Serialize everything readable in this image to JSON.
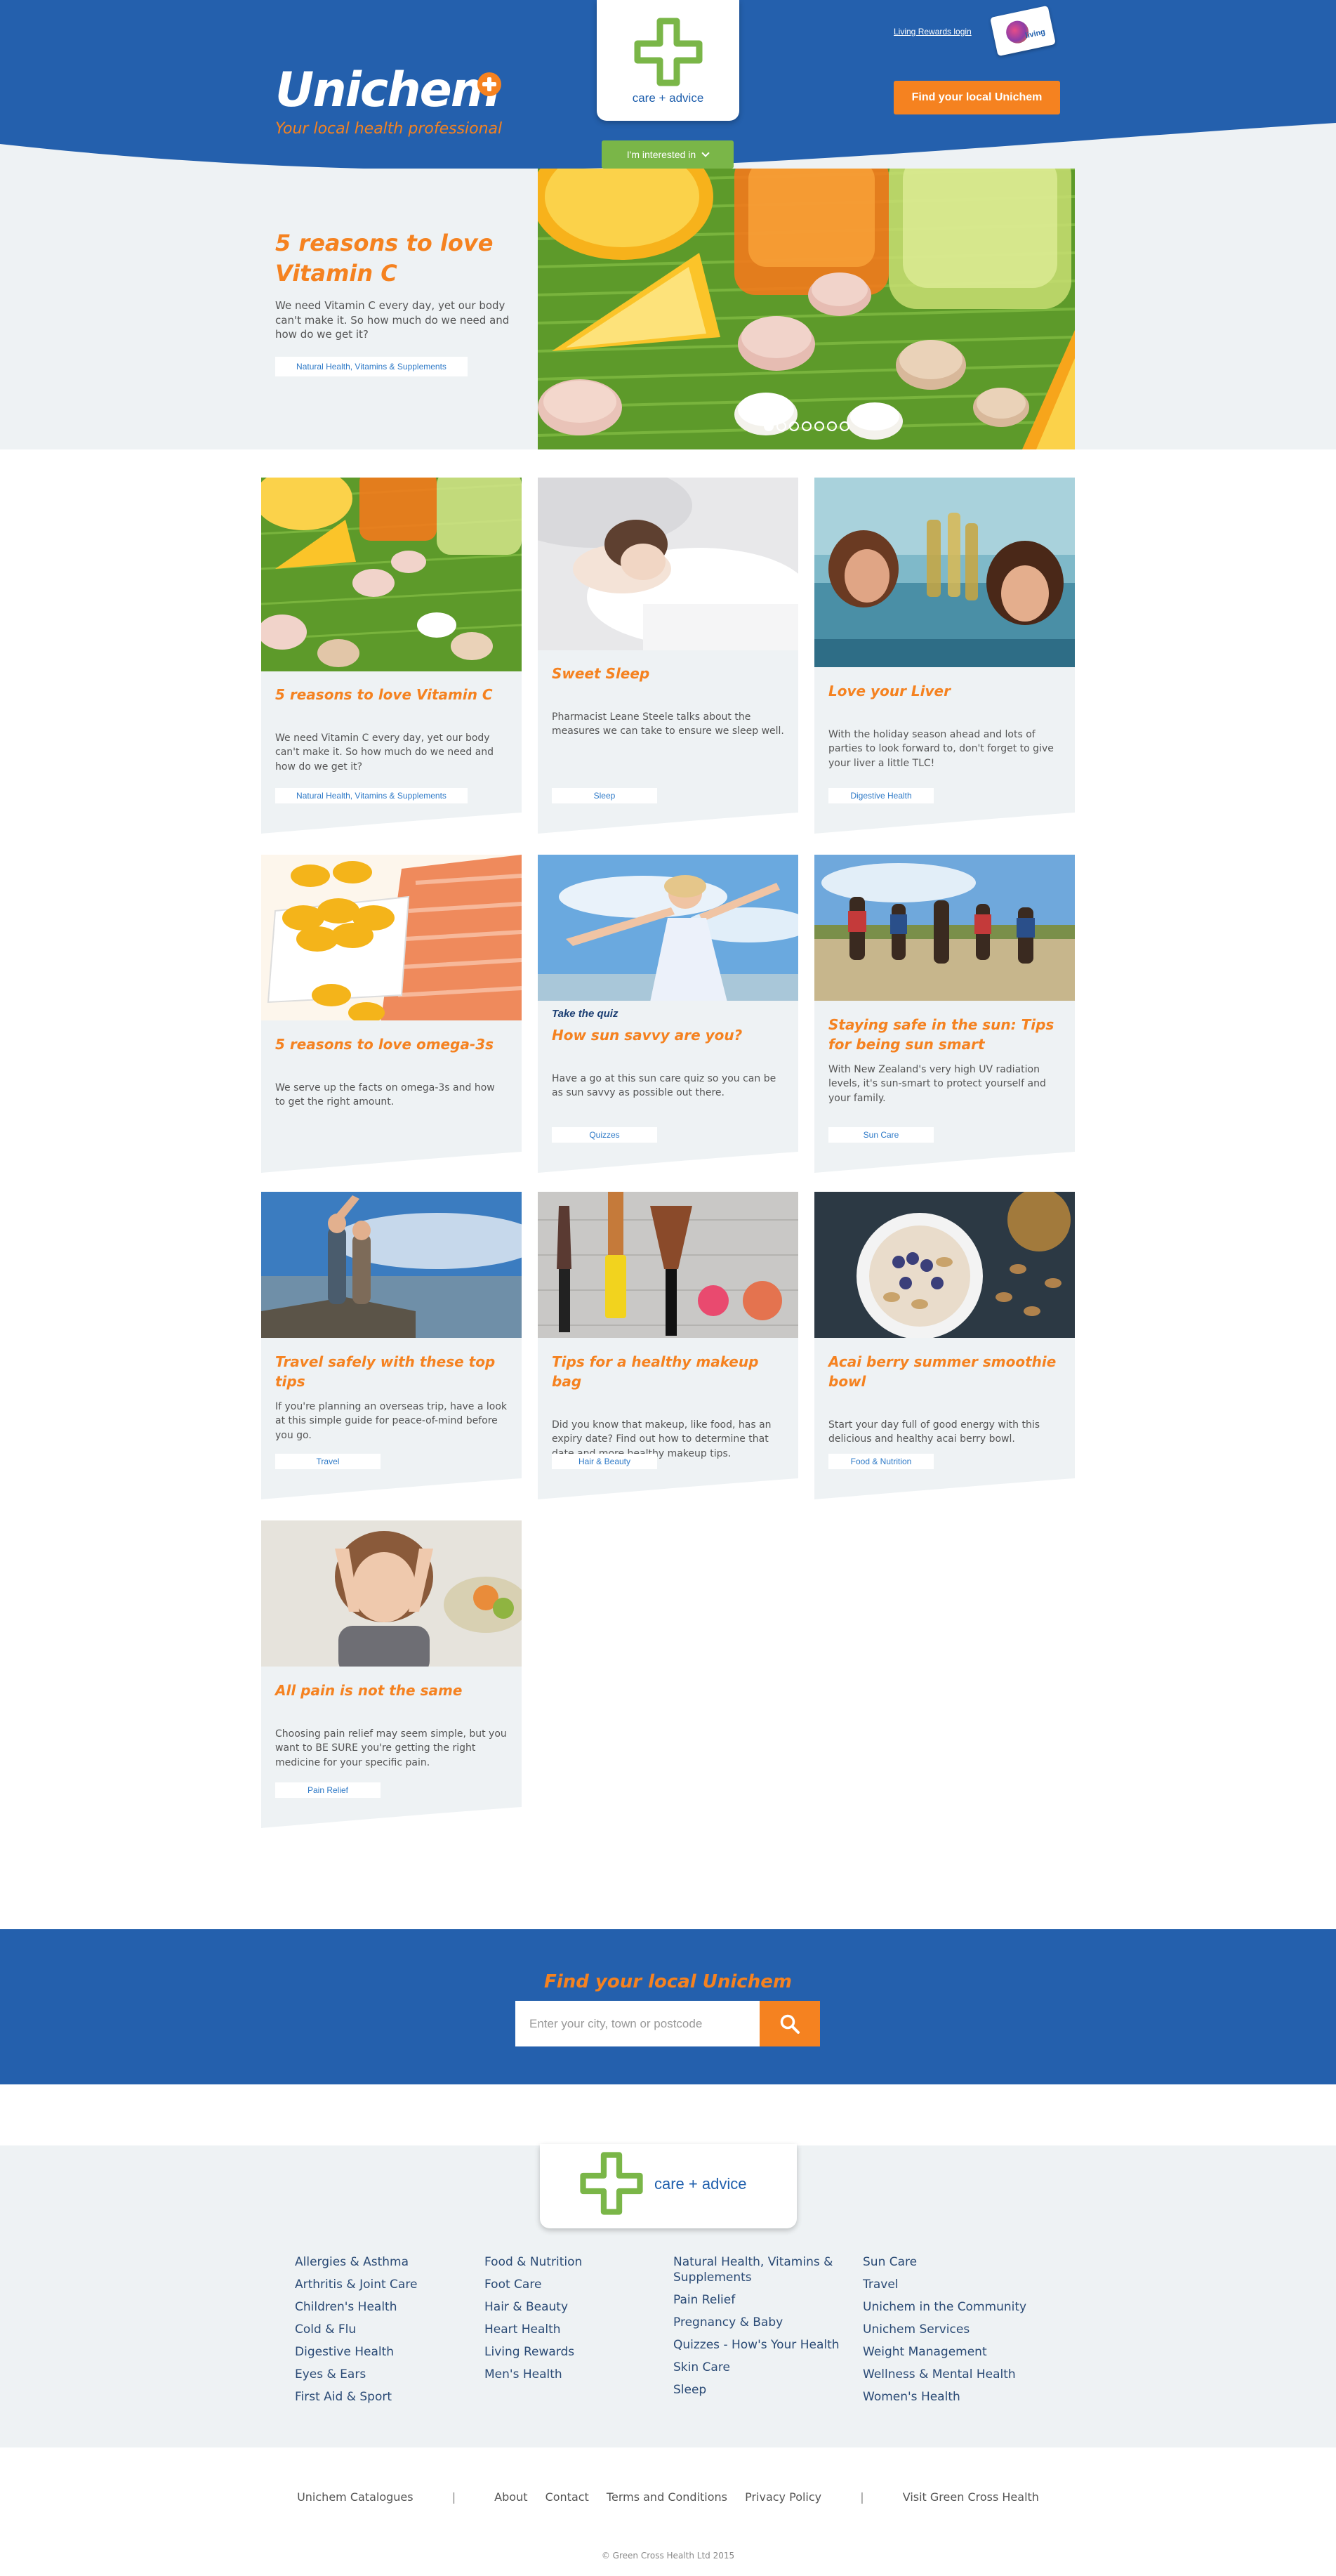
{
  "header": {
    "logo_text": "Unichem",
    "tagline": "Your local health professional",
    "care_advice_text": "care + advice",
    "interest_button": "I'm interested in",
    "rewards_link": "Living Rewards login",
    "rewards_card_text": "living",
    "find_button": "Find your local Unichem",
    "colors": {
      "blue": "#2460ad",
      "orange": "#f58220",
      "green": "#7ab648"
    }
  },
  "hero": {
    "title": "5 reasons to love Vitamin C",
    "description": "We need Vitamin C every day, yet our body can't make it. So how much do we need and how do we get it?",
    "tag": "Natural Health, Vitamins & Supplements",
    "slides_total": 7,
    "slide_active": 1
  },
  "cards": [
    {
      "kicker": "",
      "title": "5 reasons to love Vitamin C",
      "description": "We need Vitamin C every day, yet our body can't make it. So how much do we need and how do we get it?",
      "tag": "Natural Health, Vitamins & Supplements",
      "image": "oranges-tablets"
    },
    {
      "kicker": "",
      "title": "Sweet Sleep",
      "description": "Pharmacist Leane Steele talks about the measures we can take to ensure we sleep well.",
      "tag": "Sleep",
      "image": "sleeping-woman"
    },
    {
      "kicker": "",
      "title": "Love your Liver",
      "description": "With the holiday season ahead and lots of parties to look forward to, don't forget to give your liver a little TLC!",
      "tag": "Digestive Health",
      "image": "friends-toasting"
    },
    {
      "kicker": "",
      "title": "5 reasons to love omega-3s",
      "description": "We serve up the facts on omega-3s and how to get the right amount.",
      "tag": "",
      "image": "fish-oil-salmon"
    },
    {
      "kicker": "Take the quiz",
      "title": "How sun savvy are you?",
      "description": "Have a go at this sun care quiz so you can be as sun savvy as possible out there.",
      "tag": "Quizzes",
      "image": "woman-beach"
    },
    {
      "kicker": "",
      "title": "Staying safe in the sun: Tips for being sun smart",
      "description": "With New Zealand's very high UV radiation levels, it's sun-smart to protect yourself and your family.",
      "tag": "Sun Care",
      "image": "family-beach"
    },
    {
      "kicker": "",
      "title": "Travel safely with these top tips",
      "description": "If you're planning an overseas trip, have a look at this simple guide for peace-of-mind before you go.",
      "tag": "Travel",
      "image": "travellers-view"
    },
    {
      "kicker": "",
      "title": "Tips for a healthy makeup bag",
      "description": "Did you know that makeup, like food, has an expiry date? Find out how to determine that date and more healthy makeup tips.",
      "tag": "Hair & Beauty",
      "image": "makeup-brushes"
    },
    {
      "kicker": "",
      "title": "Acai berry summer smoothie bowl",
      "description": "Start your day full of good energy with this delicious and healthy acai berry bowl.",
      "tag": "Food & Nutrition",
      "image": "smoothie-bowl"
    },
    {
      "kicker": "",
      "title": "All pain is not the same",
      "description": "Choosing pain relief may seem simple, but you want to BE SURE you're getting the right medicine for your specific pain.",
      "tag": "Pain Relief",
      "image": "headache-woman"
    }
  ],
  "find": {
    "title": "Find your local Unichem",
    "placeholder": "Enter your city, town or postcode",
    "submit_icon": "search-icon"
  },
  "footer": {
    "care_advice_text": "care + advice",
    "columns": [
      [
        "Allergies & Asthma",
        "Arthritis & Joint Care",
        "Children's Health",
        "Cold & Flu",
        "Digestive Health",
        "Eyes & Ears",
        "First Aid & Sport"
      ],
      [
        "Food & Nutrition",
        "Foot Care",
        "Hair & Beauty",
        "Heart Health",
        "Living Rewards",
        "Men's Health"
      ],
      [
        "Natural Health, Vitamins & Supplements",
        "Pain Relief",
        "Pregnancy & Baby",
        "Quizzes - How's Your Health",
        "Skin Care",
        "Sleep"
      ],
      [
        "Sun Care",
        "Travel",
        "Unichem in the Community",
        "Unichem Services",
        "Weight Management",
        "Wellness & Mental Health",
        "Women's Health"
      ]
    ],
    "bottom_links": {
      "catalogues": "Unichem Catalogues",
      "about": "About",
      "contact": "Contact",
      "terms": "Terms and Conditions",
      "privacy": "Privacy Policy",
      "green_cross": "Visit Green Cross Health",
      "separator": "|"
    },
    "copyright": "© Green Cross Health Ltd 2015"
  }
}
